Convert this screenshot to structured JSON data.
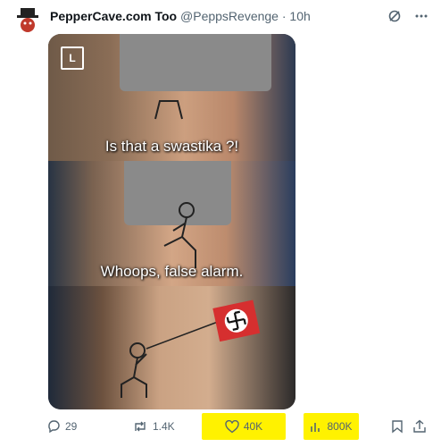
{
  "post": {
    "author_name": "PepperCave.com Too",
    "author_handle": "@PeppsRevenge",
    "separator": "·",
    "time": "10h"
  },
  "media": {
    "captions": [
      "Is that a swastika ?!",
      "Whoops, false alarm."
    ],
    "corner_logo_text": "L"
  },
  "actions": {
    "replies": "29",
    "reposts": "1.4K",
    "likes": "40K",
    "views": "800K"
  },
  "icons": [
    "grok-icon",
    "more-icon",
    "reply-icon",
    "repost-icon",
    "like-icon",
    "views-icon",
    "bookmark-icon",
    "share-icon"
  ],
  "colors": {
    "highlight": "#fff200",
    "muted": "#536471"
  }
}
